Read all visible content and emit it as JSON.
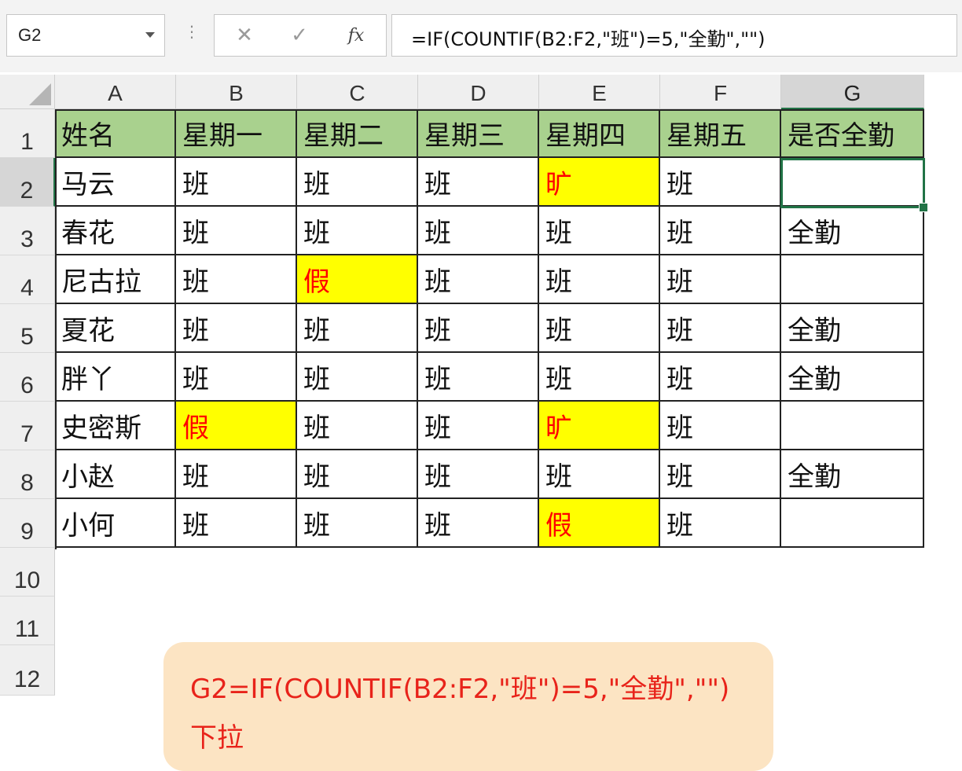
{
  "formula_bar": {
    "name_box": "G2",
    "cancel_icon": "✕",
    "enter_icon": "✓",
    "fx_label": "fx",
    "formula": "=IF(COUNTIF(B2:F2,\"班\")=5,\"全勤\",\"\")"
  },
  "columns": [
    "A",
    "B",
    "C",
    "D",
    "E",
    "F",
    "G"
  ],
  "selected_column": "G",
  "rows": [
    "1",
    "2",
    "3",
    "4",
    "5",
    "6",
    "7",
    "8",
    "9",
    "10",
    "11",
    "12"
  ],
  "selected_row": "2",
  "table": {
    "header": [
      "姓名",
      "星期一",
      "星期二",
      "星期三",
      "星期四",
      "星期五",
      "是否全勤"
    ],
    "body": [
      [
        "马云",
        "班",
        "班",
        "班",
        "旷",
        "班",
        ""
      ],
      [
        "春花",
        "班",
        "班",
        "班",
        "班",
        "班",
        "全勤"
      ],
      [
        "尼古拉",
        "班",
        "假",
        "班",
        "班",
        "班",
        ""
      ],
      [
        "夏花",
        "班",
        "班",
        "班",
        "班",
        "班",
        "全勤"
      ],
      [
        "胖丫",
        "班",
        "班",
        "班",
        "班",
        "班",
        "全勤"
      ],
      [
        "史密斯",
        "假",
        "班",
        "班",
        "旷",
        "班",
        ""
      ],
      [
        "小赵",
        "班",
        "班",
        "班",
        "班",
        "班",
        "全勤"
      ],
      [
        "小何",
        "班",
        "班",
        "班",
        "假",
        "班",
        ""
      ]
    ]
  },
  "note": {
    "line1": "G2=IF(COUNTIF(B2:F2,\"班\")=5,\"全勤\",\"\")",
    "line2": "下拉"
  },
  "colors": {
    "header_fill": "#a9d18e",
    "highlight_fill": "#ffff00",
    "highlight_text": "#ff0000",
    "selection": "#217346",
    "note_fill": "#fce4c3",
    "note_text": "#e8231a"
  }
}
